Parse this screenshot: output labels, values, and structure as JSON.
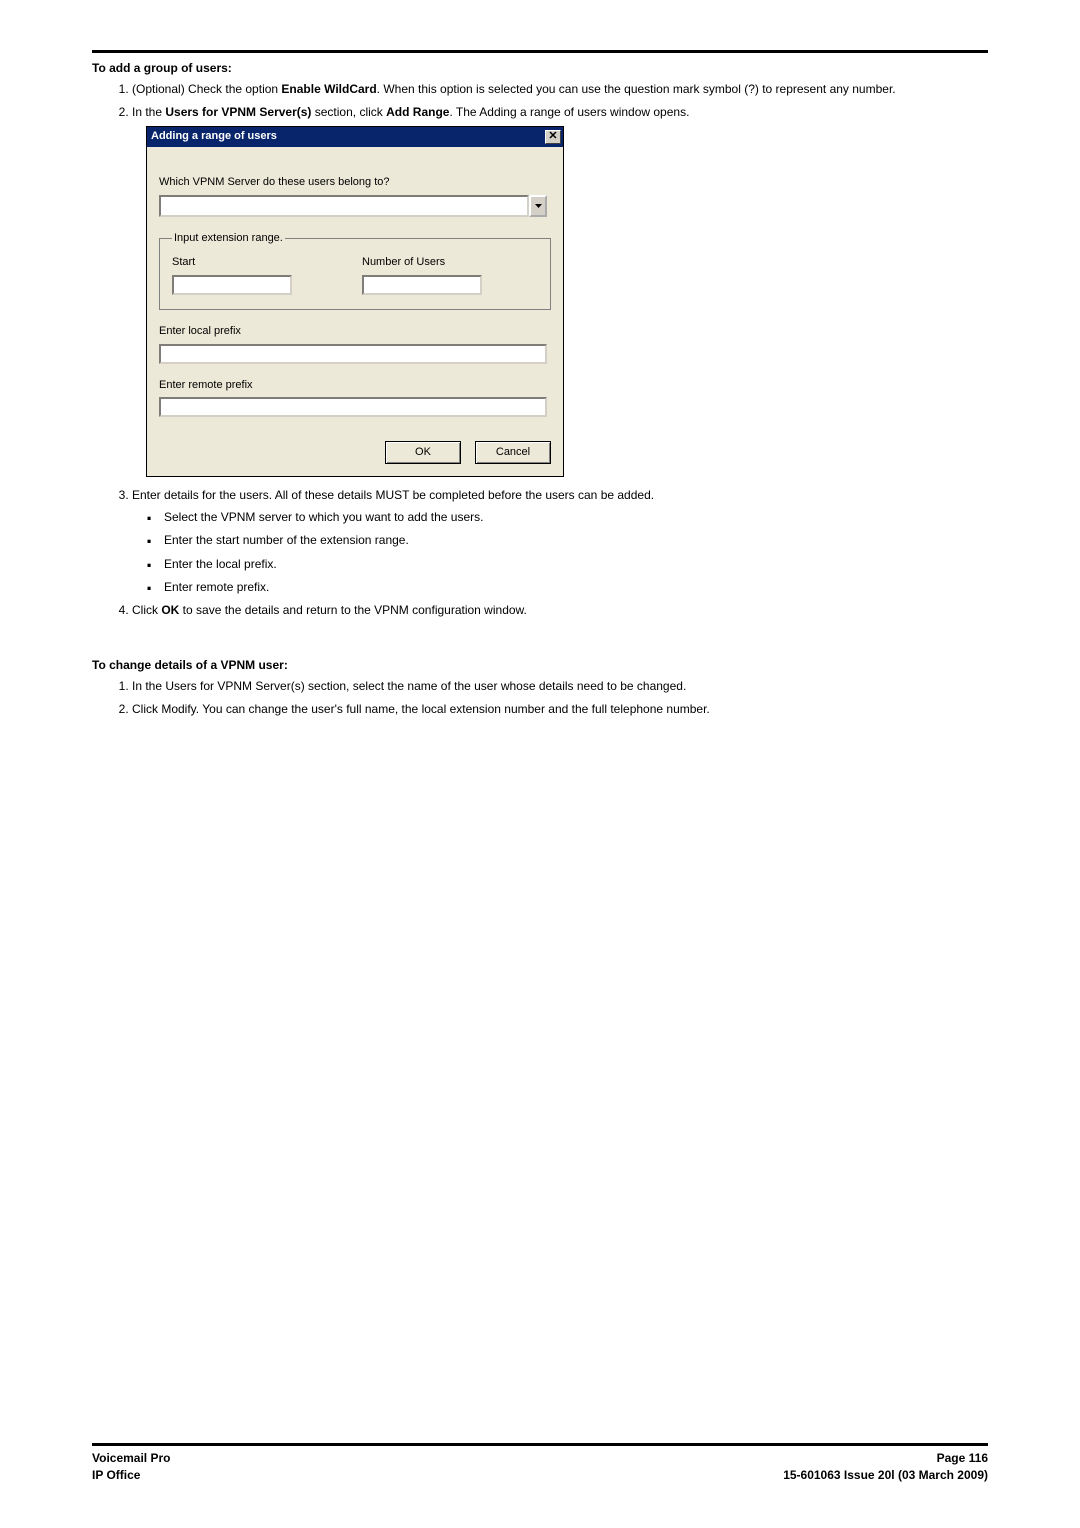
{
  "sectionA": {
    "heading": "To add a group of users:",
    "step1_pre": "(Optional) Check the option ",
    "step1_bold": "Enable WildCard",
    "step1_post": ". When this option is selected you can use the question mark symbol (?) to represent any number.",
    "step2_pre": "In the ",
    "step2_bold1": "Users for VPNM Server(s)",
    "step2_mid": " section, click ",
    "step2_bold2": "Add Range",
    "step2_post": ". The Adding a range of users window opens.",
    "step3_text": "Enter details for the users. All of these details MUST be completed before the users can be added.",
    "step3_b1": "Select the VPNM server to which you want to add the users.",
    "step3_b2": "Enter the start number of the extension range.",
    "step3_b3": "Enter the local prefix.",
    "step3_b4": "Enter remote prefix.",
    "step4_pre": "Click ",
    "step4_bold": "OK",
    "step4_post": " to save the details and return to the VPNM configuration window."
  },
  "dialog": {
    "title": "Adding a range of users",
    "server_label": "Which VPNM Server do these users belong to?",
    "group_legend": "Input extension range.",
    "start_label": "Start",
    "numusers_label": "Number of Users",
    "local_prefix_label": "Enter local prefix",
    "remote_prefix_label": "Enter remote prefix",
    "ok_label": "OK",
    "cancel_label": "Cancel"
  },
  "sectionB": {
    "heading": "To change details of a VPNM user:",
    "step1": "In the Users for VPNM Server(s) section, select the name of the user whose details need to be changed.",
    "step2": "Click Modify. You can change the user's full name, the local extension number and the full telephone number."
  },
  "footer": {
    "left1": "Voicemail Pro",
    "left2": "IP Office",
    "right1": "Page 116",
    "right2": "15-601063 Issue 20l (03 March 2009)"
  }
}
